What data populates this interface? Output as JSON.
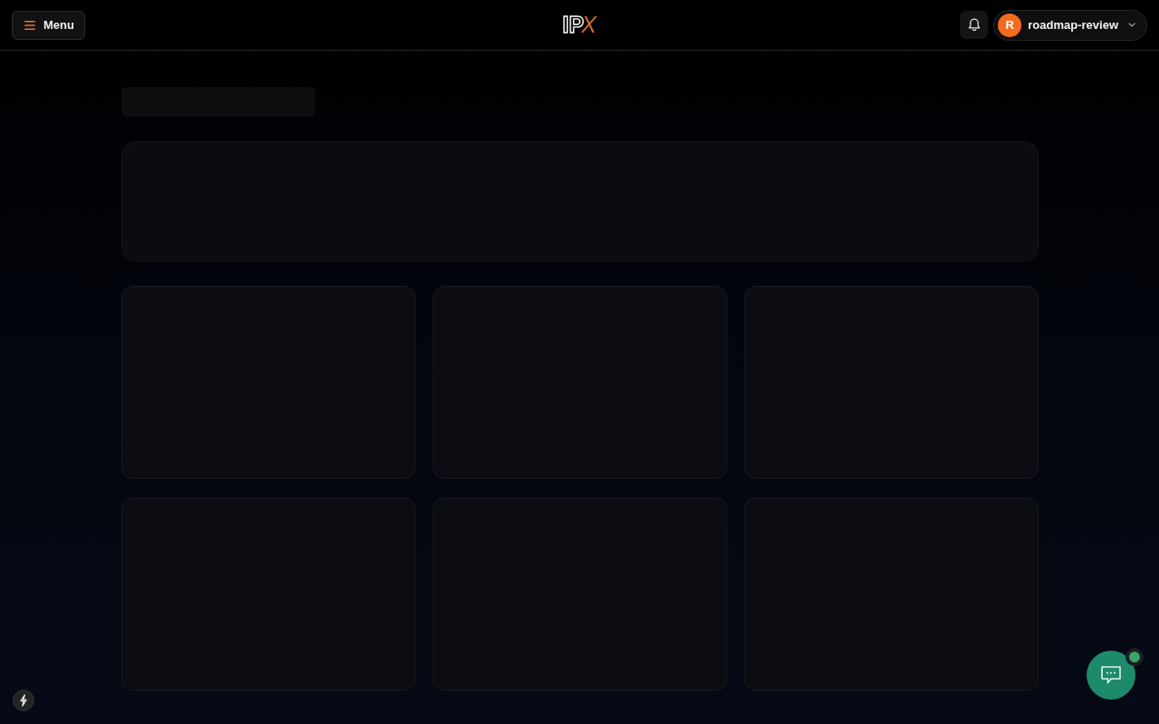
{
  "header": {
    "menu_button": {
      "label": "Menu"
    },
    "logo": {
      "main": "IP",
      "accent": "X"
    },
    "user": {
      "initial": "R",
      "name": "roadmap-review"
    }
  },
  "skeleton": [
    {
      "kind": "title"
    },
    {
      "kind": "banner"
    },
    {
      "kind": "card"
    },
    {
      "kind": "card"
    },
    {
      "kind": "card"
    },
    {
      "kind": "card"
    },
    {
      "kind": "card"
    },
    {
      "kind": "card"
    }
  ],
  "chat_button": {
    "online": true
  }
}
